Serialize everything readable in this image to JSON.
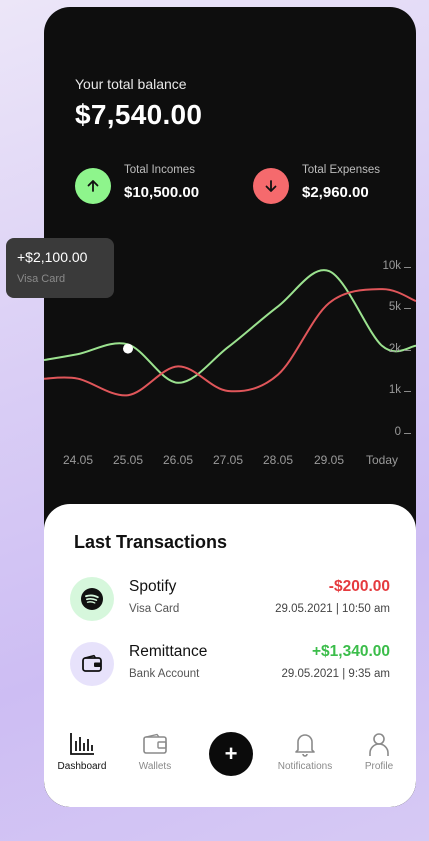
{
  "balance": {
    "label": "Your total balance",
    "amount": "$7,540.00"
  },
  "stats": {
    "incomes": {
      "label": "Total Incomes",
      "value": "$10,500.00",
      "icon": "arrow-up-icon",
      "color": "#8ef58c"
    },
    "expenses": {
      "label": "Total Expenses",
      "value": "$2,960.00",
      "icon": "arrow-down-icon",
      "color": "#f56a6d"
    }
  },
  "tooltip": {
    "amount": "+$2,100.00",
    "card": "Visa Card"
  },
  "chart_data": {
    "type": "line",
    "categories": [
      "24.05",
      "25.05",
      "26.05",
      "27.05",
      "28.05",
      "29.05",
      "Today"
    ],
    "y_ticks": [
      "10k",
      "5k",
      "2k",
      "1k",
      "0"
    ],
    "series": [
      {
        "color": "#9be28f",
        "values": [
          1900,
          2400,
          1200,
          2200,
          5200,
          9500,
          2300
        ]
      },
      {
        "color": "#e0565a",
        "values": [
          1300,
          900,
          1600,
          1000,
          1400,
          5600,
          7300
        ]
      }
    ],
    "highlight_point": {
      "series": 0,
      "x": "25.05",
      "value": 2100
    },
    "grid": false
  },
  "transactions": {
    "title": "Last Transactions",
    "items": [
      {
        "name": "Spotify",
        "sub": "Visa Card",
        "amount": "-$200.00",
        "date": "29.05.2021 | 10:50 am",
        "icon": "spotify-icon",
        "amount_color": "#e53a3e"
      },
      {
        "name": "Remittance",
        "sub": "Bank Account",
        "amount": "+$1,340.00",
        "date": "29.05.2021 | 9:35 am",
        "icon": "wallet-icon",
        "amount_color": "#3bbd4a"
      }
    ]
  },
  "nav": {
    "dashboard": "Dashboard",
    "wallets": "Wallets",
    "add": "+",
    "notifications": "Notifications",
    "profile": "Profile",
    "active": "dashboard"
  }
}
